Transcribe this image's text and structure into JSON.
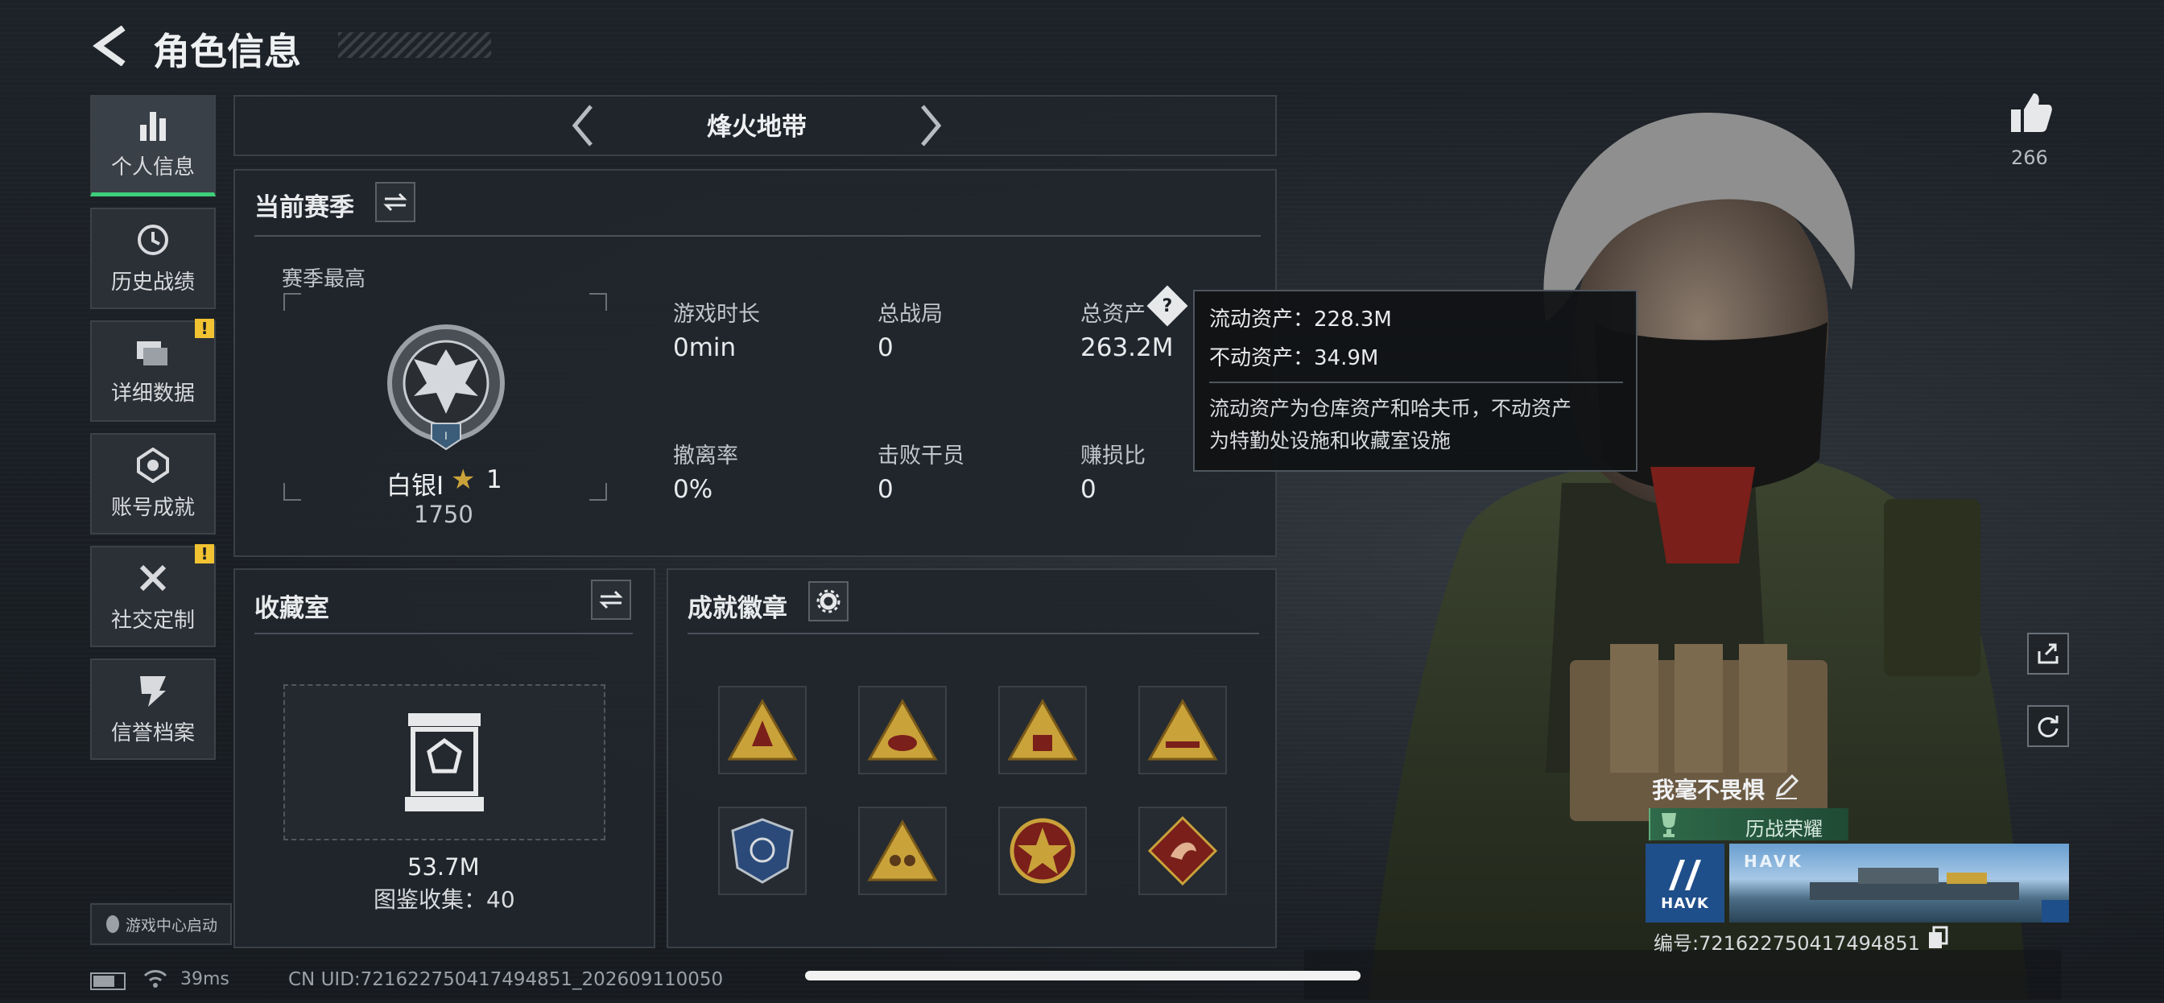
{
  "header": {
    "title": "角色信息"
  },
  "sidebar": {
    "items": [
      {
        "label": "个人信息",
        "icon": "bar-chart-icon"
      },
      {
        "label": "历史战绩",
        "icon": "history-icon"
      },
      {
        "label": "详细数据",
        "icon": "folder-icon",
        "alert": "!"
      },
      {
        "label": "账号成就",
        "icon": "achievement-icon"
      },
      {
        "label": "社交定制",
        "icon": "tools-icon",
        "alert": "!"
      },
      {
        "label": "信誉档案",
        "icon": "credit-icon"
      }
    ],
    "game_center": "游戏中心启动"
  },
  "mode_selector": {
    "label": "烽火地带"
  },
  "season": {
    "title": "当前赛季",
    "highest_label": "赛季最高",
    "rank_name": "白银I",
    "stars": "1",
    "rank_score": "1750",
    "stats": {
      "play_time_label": "游戏时长",
      "play_time": "0min",
      "total_matches_label": "总战局",
      "total_matches": "0",
      "total_assets_label": "总资产",
      "total_assets": "263.2M",
      "extract_rate_label": "撤离率",
      "extract_rate": "0%",
      "operators_defeated_label": "击败干员",
      "operators_defeated": "0",
      "profit_ratio_label": "赚损比",
      "profit_ratio": "0"
    }
  },
  "tooltip": {
    "liquid": "流动资产：228.3M",
    "fixed": "不动资产：34.9M",
    "desc_line1": "流动资产为仓库资产和哈夫币，不动资产",
    "desc_line2": "为特勤处设施和收藏室设施"
  },
  "collection": {
    "title": "收藏室",
    "value": "53.7M",
    "catalog": "图鉴收集：40"
  },
  "achievements": {
    "title": "成就徽章"
  },
  "likes": {
    "count": "266"
  },
  "player_card": {
    "name": "我毫不畏惧",
    "honor": "历战荣耀",
    "brand": "HAVK",
    "banner_text": "HAVK",
    "uid": "编号:721622750417494851"
  },
  "status_bar": {
    "ping": "39ms",
    "cn_uid": "CN UID:721622750417494851_202609110050"
  },
  "colors": {
    "accent_green": "#3ecf7a",
    "warning_yellow": "#f1c232",
    "badge_gold": "#c9a23a",
    "badge_red": "#7a1f1a"
  }
}
